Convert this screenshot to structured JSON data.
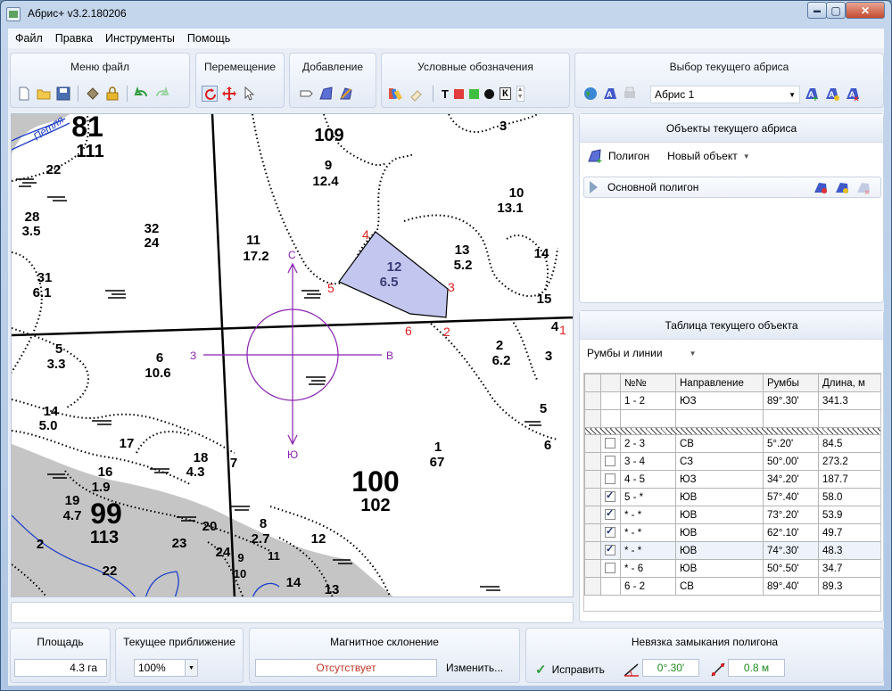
{
  "app": {
    "title": "Абрис+ v3.2.180206"
  },
  "window_controls": {
    "minimize": "▬",
    "maximize": "▢",
    "close": "✕"
  },
  "menu": [
    "Файл",
    "Правка",
    "Инструменты",
    "Помощь"
  ],
  "toolbar": {
    "file_menu_label": "Меню файл",
    "move_label": "Перемещение",
    "add_label": "Добавление",
    "symbols_label": "Условные обозначения",
    "select_label": "Выбор текущего абриса",
    "text_tool": "Т",
    "k_tool": "К",
    "colors": {
      "red": "#e23b3b",
      "green": "#3fbf3f",
      "black": "#111111"
    }
  },
  "abris_select": {
    "value": "Абрис 1",
    "arrow": "▼"
  },
  "objects_panel": {
    "title": "Объекты текущего абриса",
    "type_label": "Полигон",
    "new_object_label": "Новый объект",
    "arrow": "▼",
    "items": [
      {
        "label": "Основной полигон"
      }
    ]
  },
  "table_panel": {
    "title": "Таблица текущего объекта",
    "mode": "Румбы и линии",
    "arrow": "▼",
    "columns": [
      "№№",
      "Направление",
      "Румбы",
      "Длина, м"
    ],
    "rows": [
      {
        "check": "none",
        "num": "1 - 2",
        "dir": "ЮЗ",
        "rumb": "89°.30'",
        "len": "341.3"
      },
      {
        "check": "empty",
        "num": "",
        "dir": "",
        "rumb": "",
        "len": ""
      },
      {
        "check": "hatch",
        "num": "",
        "dir": "",
        "rumb": "",
        "len": ""
      },
      {
        "check": "off",
        "num": "2 - 3",
        "dir": "СВ",
        "rumb": "5°.20'",
        "len": "84.5"
      },
      {
        "check": "off",
        "num": "3 - 4",
        "dir": "СЗ",
        "rumb": "50°.00'",
        "len": "273.2"
      },
      {
        "check": "off",
        "num": "4 - 5",
        "dir": "ЮЗ",
        "rumb": "34°.20'",
        "len": "187.7"
      },
      {
        "check": "on",
        "num": "5 - *",
        "dir": "ЮВ",
        "rumb": "57°.40'",
        "len": "58.0"
      },
      {
        "check": "on",
        "num": "* - *",
        "dir": "ЮВ",
        "rumb": "73°.20'",
        "len": "53.9"
      },
      {
        "check": "on",
        "num": "* - *",
        "dir": "ЮВ",
        "rumb": "62°.10'",
        "len": "49.7"
      },
      {
        "check": "on",
        "num": "* - *",
        "dir": "ЮВ",
        "rumb": "74°.30'",
        "len": "48.3"
      },
      {
        "check": "off",
        "num": "* - 6",
        "dir": "ЮВ",
        "rumb": "50°.50'",
        "len": "34.7"
      },
      {
        "check": "none",
        "num": "6 - 2",
        "dir": "СВ",
        "rumb": "89°.40'",
        "len": "89.3"
      }
    ]
  },
  "bottom": {
    "area_label": "Площадь",
    "area_value": "4.3 га",
    "zoom_label": "Текущее приближение",
    "zoom_value": "100%",
    "zoom_arrow": "▼",
    "magnetic_label": "Магнитное склонение",
    "magnetic_value": "Отсутствует",
    "change_label": "Изменить...",
    "closure_label": "Невязка замыкания полигона",
    "fix_label": "Исправить",
    "angle_value": "0°.30'",
    "distance_value": "0.8 м",
    "colors": {
      "magnetic_value": "#c0392b",
      "closure_values": "#1e8b1e"
    }
  },
  "map": {
    "compass": {
      "n": "С",
      "s": "Ю",
      "w": "З",
      "e": "В"
    },
    "forest_numbers": [
      "81",
      "111",
      "22",
      "28",
      "3.5",
      "31",
      "6.1",
      "32",
      "24",
      "11",
      "17.2",
      "9",
      "12.4",
      "3",
      "10",
      "13.1",
      "13",
      "5.2",
      "14",
      "15",
      "4",
      "5",
      "3.3",
      "6",
      "10.6",
      "2",
      "6.2",
      "3",
      "5",
      "6",
      "14",
      "5.0",
      "17",
      "16",
      "1.9",
      "18",
      "4.3",
      "7",
      "19",
      "4.7",
      "99",
      "113",
      "2",
      "22",
      "23",
      "20",
      "24",
      "9",
      "10",
      "8",
      "2.7",
      "11",
      "12",
      "14",
      "13",
      "1",
      "67",
      "100",
      "102",
      "109"
    ],
    "plot_area": {
      "number": "12",
      "area": "6.5"
    },
    "vertex_labels": [
      "1",
      "2",
      "3",
      "4",
      "5",
      "6"
    ],
    "river_label": "Петля",
    "colors": {
      "polygon_fill": "#c3c6ee",
      "compass": "#8a22b0",
      "vertex": "#e02020",
      "river": "#1f3fc8",
      "gray_zone": "#c5c5c5"
    }
  }
}
